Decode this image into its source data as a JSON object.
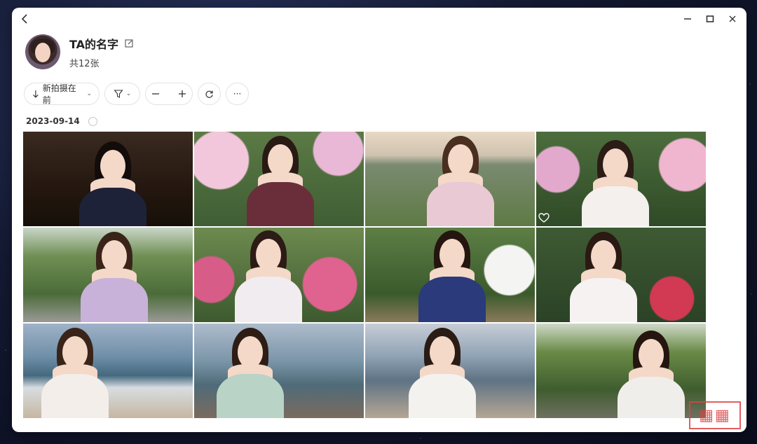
{
  "window": {
    "title": "TA的名字",
    "photo_count": "共12张"
  },
  "toolbar": {
    "sort_label": "新拍摄在前",
    "more_label": "···"
  },
  "group": {
    "date": "2023-09-14"
  },
  "photos": [
    {
      "id": 1,
      "scene": "indoor-dark"
    },
    {
      "id": 2,
      "scene": "hydrangea-pink"
    },
    {
      "id": 3,
      "scene": "seaside-grass"
    },
    {
      "id": 4,
      "scene": "hydrangea-garden",
      "favorite": true
    },
    {
      "id": 5,
      "scene": "garden-path"
    },
    {
      "id": 6,
      "scene": "pink-flowers"
    },
    {
      "id": 7,
      "scene": "white-flowers"
    },
    {
      "id": 8,
      "scene": "red-roses"
    },
    {
      "id": 9,
      "scene": "beach-waves"
    },
    {
      "id": 10,
      "scene": "lakeside-walk"
    },
    {
      "id": 11,
      "scene": "beach-evening"
    },
    {
      "id": 12,
      "scene": "forest-stream"
    }
  ],
  "icons": {
    "back": "chevron-left-icon",
    "minimize": "minimize-icon",
    "maximize": "maximize-icon",
    "close": "close-icon",
    "edit": "edit-icon",
    "sort": "arrow-down-icon",
    "filter": "filter-icon",
    "zoom_out": "minus-icon",
    "zoom_in": "plus-icon",
    "refresh": "refresh-icon",
    "favorite": "heart-icon"
  },
  "colors": {
    "window_bg": "#ffffff",
    "text": "#222222",
    "border": "#e2e2e2"
  }
}
